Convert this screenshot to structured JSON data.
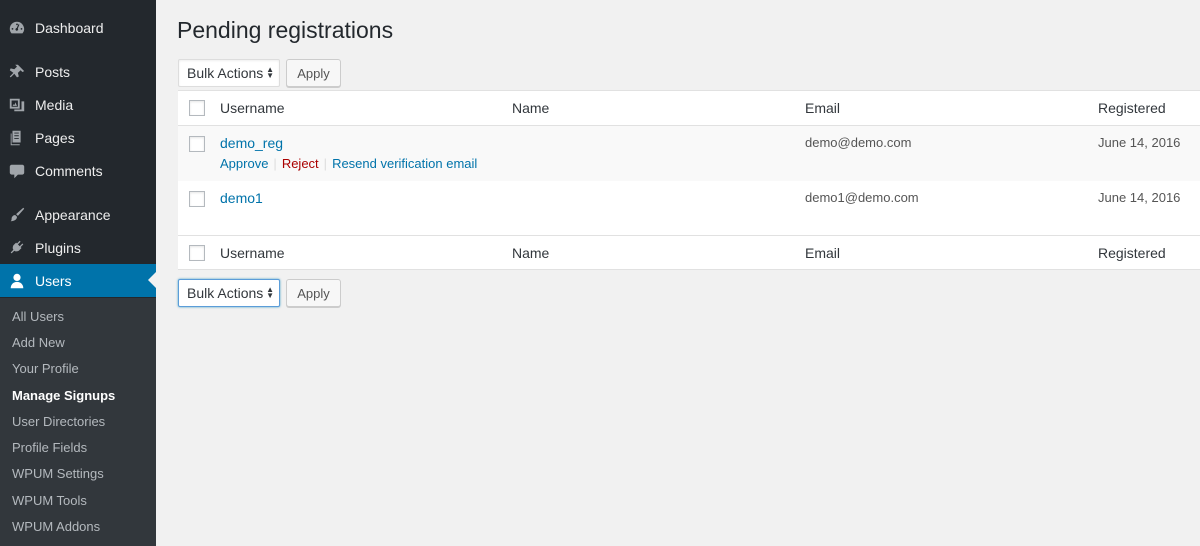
{
  "sidebar": {
    "items": [
      {
        "label": "Dashboard",
        "icon": "dashboard-icon"
      },
      {
        "label": "Posts",
        "icon": "pin-icon"
      },
      {
        "label": "Media",
        "icon": "media-icon"
      },
      {
        "label": "Pages",
        "icon": "pages-icon"
      },
      {
        "label": "Comments",
        "icon": "comment-icon"
      },
      {
        "label": "Appearance",
        "icon": "brush-icon"
      },
      {
        "label": "Plugins",
        "icon": "plugin-icon"
      },
      {
        "label": "Users",
        "icon": "user-icon"
      }
    ],
    "submenu": [
      "All Users",
      "Add New",
      "Your Profile",
      "Manage Signups",
      "User Directories",
      "Profile Fields",
      "WPUM Settings",
      "WPUM Tools",
      "WPUM Addons"
    ],
    "active_item": "Users",
    "current_submenu": "Manage Signups",
    "accent_color": "#0073aa"
  },
  "page": {
    "title": "Pending registrations"
  },
  "bulk_top": {
    "select": "Bulk Actions",
    "apply": "Apply"
  },
  "bulk_bottom": {
    "select": "Bulk Actions",
    "apply": "Apply"
  },
  "table": {
    "columns": [
      "Username",
      "Name",
      "Email",
      "Registered"
    ],
    "rows": [
      {
        "username": "demo_reg",
        "name": "",
        "email": "demo@demo.com",
        "registered": "June 14, 2016",
        "actions": [
          "Approve",
          "Reject",
          "Resend verification email"
        ]
      },
      {
        "username": "demo1",
        "name": "",
        "email": "demo1@demo.com",
        "registered": "June 14, 2016"
      }
    ]
  }
}
